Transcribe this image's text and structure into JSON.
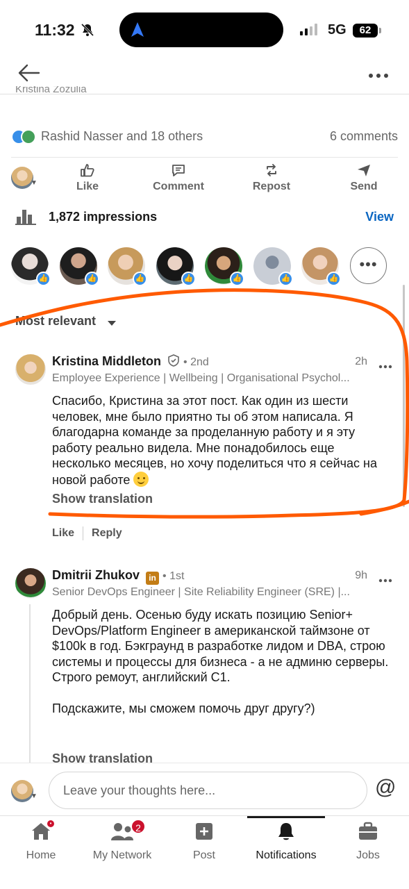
{
  "status_bar": {
    "time": "11:32",
    "network": "5G",
    "battery": "62"
  },
  "post": {
    "author_partial": "Kristina Zozulia",
    "reactions_text": "Rashid Nasser and 18 others",
    "comments_count": "6 comments",
    "actions": {
      "like": "Like",
      "comment": "Comment",
      "repost": "Repost",
      "send": "Send"
    },
    "impressions": "1,872 impressions",
    "view_label": "View",
    "reactor_badge_icon": "like-icon",
    "reactors_count_shown": 7
  },
  "sort": {
    "label": "Most relevant"
  },
  "comments": [
    {
      "name": "Kristina Middleton",
      "degree": "• 2nd",
      "time": "2h",
      "headline": "Employee Experience | Wellbeing | Organisational Psychol...",
      "body": "Спасибо, Кристина за этот пост. Как один из шести человек, мне было приятно ты об этом написала. Я благодарна команде за проделанную работу и я эту работу реально видела. Мне понадобилось еще несколько месяцев, но хочу поделиться что я сейчас на новой работе",
      "translate": "Show translation",
      "like": "Like",
      "reply": "Reply"
    },
    {
      "name": "Dmitrii Zhukov",
      "degree": "• 1st",
      "time": "9h",
      "headline": "Senior DevOps Engineer | Site Reliability Engineer (SRE) |...",
      "body": "Добрый день. Осенью буду искать позицию Senior+ DevOps/Platform Engineer в американской таймзоне от $100k в год. Бэкграунд в разработке лидом и DBA, строю системы и процессы для бизнеса - а не админю серверы.\nСтрого ремоут, английский C1.\n\nПодскажите, мы сможем помочь друг другу?)",
      "translate": "Show translation"
    }
  ],
  "compose": {
    "placeholder": "Leave your thoughts here...",
    "at": "@"
  },
  "tabs": [
    {
      "label": "Home",
      "icon": "home-icon"
    },
    {
      "label": "My Network",
      "icon": "network-icon",
      "badge": "2"
    },
    {
      "label": "Post",
      "icon": "post-icon"
    },
    {
      "label": "Notifications",
      "icon": "bell-icon",
      "active": true
    },
    {
      "label": "Jobs",
      "icon": "jobs-icon"
    }
  ],
  "colors": {
    "accent_blue": "#0a66c2",
    "annotation_orange": "#ff5a00",
    "badge_red": "#cb112d"
  }
}
